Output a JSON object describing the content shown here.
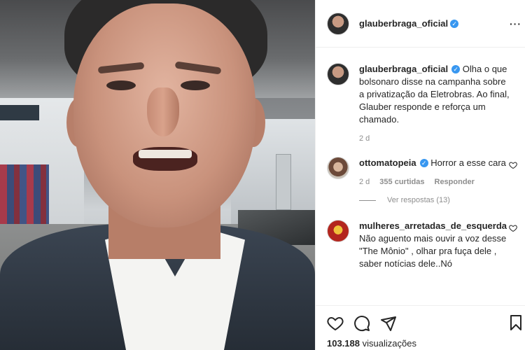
{
  "post": {
    "author": "glauberbraga_oficial",
    "verified_mark": "✓",
    "more_icon": "···"
  },
  "caption": {
    "username": "glauberbraga_oficial",
    "text": "Olha o que bolsonaro disse na campanha sobre a privatização da Eletrobras. Ao final, Glauber responde e reforça um chamado.",
    "time": "2 d"
  },
  "comments": [
    {
      "username": "ottomatopeia",
      "text": "Horror a esse cara",
      "time": "2 d",
      "likes": "355 curtidas",
      "reply_label": "Responder",
      "view_replies": "Ver respostas (13)"
    },
    {
      "username": "mulheres_arretadas_de_esquerda",
      "text": "Não aguento mais ouvir a voz desse \"The Mônio\" , olhar pra fuça dele , saber notícias dele..Nó"
    }
  ],
  "actions": {
    "like_icon": "heart-icon",
    "comment_icon": "comment-icon",
    "share_icon": "share-icon",
    "save_icon": "bookmark-icon"
  },
  "views": {
    "count": "103.188",
    "label": "visualizações"
  },
  "colors": {
    "verified": "#3897f0",
    "secondary_text": "#8e8e8e",
    "primary_text": "#262626"
  }
}
